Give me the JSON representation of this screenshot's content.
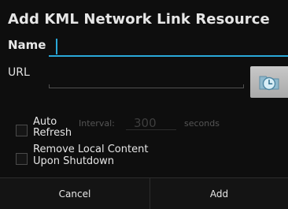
{
  "dialog": {
    "title": "Add KML Network Link Resource",
    "name_label": "Name",
    "url_label": "URL",
    "browse_icon": "folder-clock-icon",
    "auto_refresh_label": "Auto Refresh",
    "auto_refresh_checked": false,
    "interval_label": "Interval:",
    "interval_value": "300",
    "seconds_label": "seconds",
    "remove_local_label": "Remove Local Content Upon Shutdown",
    "remove_local_checked": false
  },
  "buttons": {
    "cancel": "Cancel",
    "add": "Add"
  },
  "colors": {
    "accent": "#2aa8d8",
    "background": "#0e0e0e"
  }
}
